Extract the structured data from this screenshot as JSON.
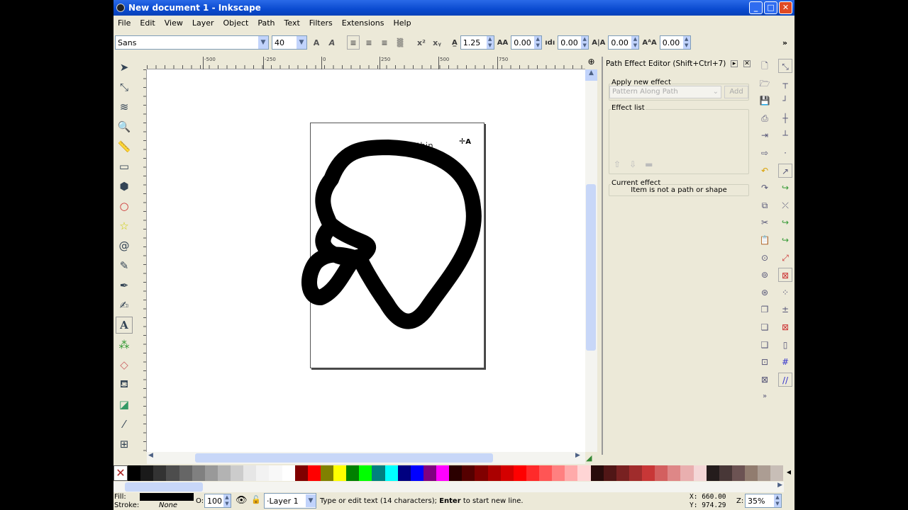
{
  "window": {
    "title": "New document 1 - Inkscape",
    "minimize": "_",
    "maximize": "□",
    "close": "✕"
  },
  "menu": [
    "File",
    "Edit",
    "View",
    "Layer",
    "Object",
    "Path",
    "Text",
    "Filters",
    "Extensions",
    "Help"
  ],
  "text_toolbar": {
    "font_family": "Sans",
    "font_size": "40",
    "line_spacing": "1.25",
    "letter_spacing": "0.00",
    "word_spacing": "0.00",
    "horizontal_kern": "0.00",
    "vertical_shift": "0.00",
    "more": "»"
  },
  "ruler": {
    "top_labels": [
      "-500",
      "-250",
      "0",
      "250",
      "500",
      "750"
    ]
  },
  "canvas": {
    "text": "I want it thin"
  },
  "dialog": {
    "title": "Path Effect Editor (Shift+Ctrl+7)",
    "apply_new_effect": "Apply new effect",
    "effect_select": "Pattern Along Path",
    "add_button": "Add",
    "effect_list": "Effect list",
    "current_effect": "Current effect",
    "current_effect_value": "Item is not a path or shape"
  },
  "palette": [
    "#000000",
    "#1a1a1a",
    "#333333",
    "#4d4d4d",
    "#666666",
    "#808080",
    "#999999",
    "#b3b3b3",
    "#cccccc",
    "#e6e6e6",
    "#f2f2f2",
    "#f8f8f8",
    "#ffffff",
    "#800000",
    "#ff0000",
    "#808000",
    "#ffff00",
    "#008000",
    "#00ff00",
    "#008080",
    "#00ffff",
    "#000080",
    "#0000ff",
    "#800080",
    "#ff00ff",
    "#2b0000",
    "#550000",
    "#800000",
    "#aa0000",
    "#d40000",
    "#ff0000",
    "#ff2a2a",
    "#ff5555",
    "#ff8080",
    "#ffaaaa",
    "#ffd5d5",
    "#280b0b",
    "#501616",
    "#782121",
    "#a02c2c",
    "#c83737",
    "#d35f5f",
    "#de8787",
    "#e9afaf",
    "#f4d7d7",
    "#241c1c",
    "#483737",
    "#6c5353",
    "#917c6f",
    "#ac9d93",
    "#c8beb7"
  ],
  "status": {
    "fill_label": "Fill:",
    "stroke_label": "Stroke:",
    "stroke_value": "None",
    "fill_color": "#000000",
    "opacity_label": "O:",
    "opacity": "100",
    "layer": "·Layer 1",
    "message_pre": "Type or edit text (14 characters); ",
    "message_bold": "Enter",
    "message_post": " to start new line.",
    "x_label": "X:",
    "x": "660.00",
    "y_label": "Y:",
    "y": "974.29",
    "zoom_label": "Z:",
    "zoom": "35%"
  }
}
